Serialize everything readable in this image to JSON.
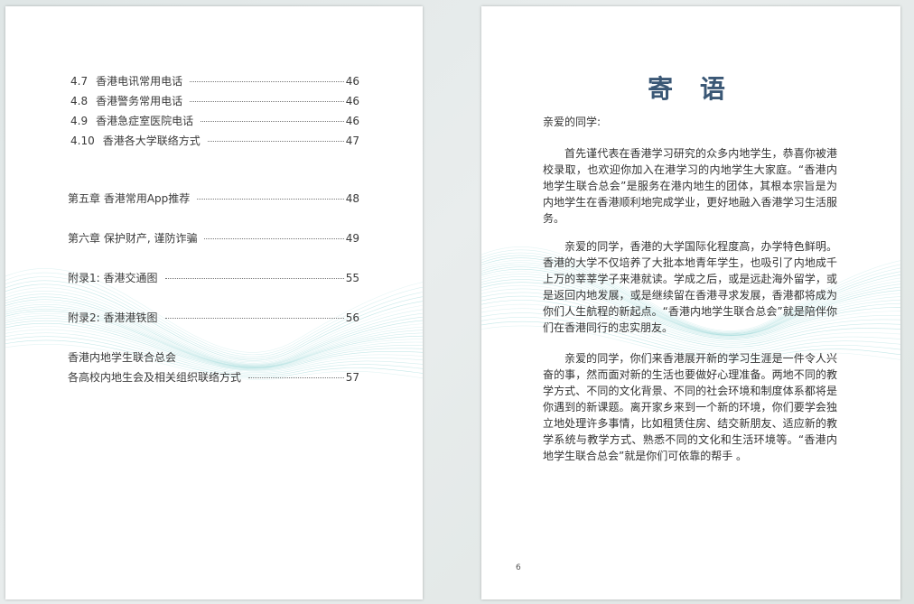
{
  "left_page": {
    "toc": [
      {
        "number": "4.7",
        "title": "香港电讯常用电话",
        "page": "46"
      },
      {
        "number": "4.8",
        "title": "香港警务常用电话",
        "page": "46"
      },
      {
        "number": "4.9",
        "title": "香港急症室医院电话",
        "page": "46"
      },
      {
        "number": "4.10",
        "title": "香港各大学联络方式",
        "page": "47"
      },
      {
        "title": "第五章  香港常用App推荐",
        "page": "48"
      },
      {
        "title": "第六章  保护财产, 谨防诈骗",
        "page": "49"
      },
      {
        "title": "附录1:   香港交通图",
        "page": "55"
      },
      {
        "title": "附录2:   香港港铁图",
        "page": "56"
      }
    ],
    "last_entry": {
      "line1": "香港内地学生联合总会",
      "line2": "各高校内地生会及相关组织联络方式",
      "page": "57"
    }
  },
  "right_page": {
    "title": "寄 语",
    "salutation": "亲爱的同学:",
    "paragraphs": [
      "首先谨代表在香港学习研究的众多内地学生，恭喜你被港校录取，也欢迎你加入在港学习的内地学生大家庭。“香港内地学生联合总会”是服务在港内地生的团体，其根本宗旨是为内地学生在香港顺利地完成学业，更好地融入香港学习生活服务。",
      "亲爱的同学，香港的大学国际化程度高，办学特色鲜明。香港的大学不仅培养了大批本地青年学生，也吸引了内地成千上万的莘莘学子来港就读。学成之后，或是远赴海外留学，或是返回内地发展，或是继续留在香港寻求发展，香港都将成为你们人生航程的新起点。“香港内地学生联合总会”就是陪伴你们在香港同行的忠实朋友。",
      "亲爱的同学，你们来香港展开新的学习生涯是一件令人兴奋的事，然而面对新的生活也要做好心理准备。两地不同的教学方式、不同的文化背景、不同的社会环境和制度体系都将是你遇到的新课题。离开家乡来到一个新的环境，你们要学会独立地处理许多事情，比如租赁住房、结交新朋友、适应新的教学系统与教学方式、熟悉不同的文化和生活环境等。“香港内地学生联合总会”就是你们可依靠的帮手 。"
    ],
    "page_number": "6"
  },
  "colors": {
    "title_blue": "#3a5775",
    "wave_teal": "#8fd3d3"
  }
}
